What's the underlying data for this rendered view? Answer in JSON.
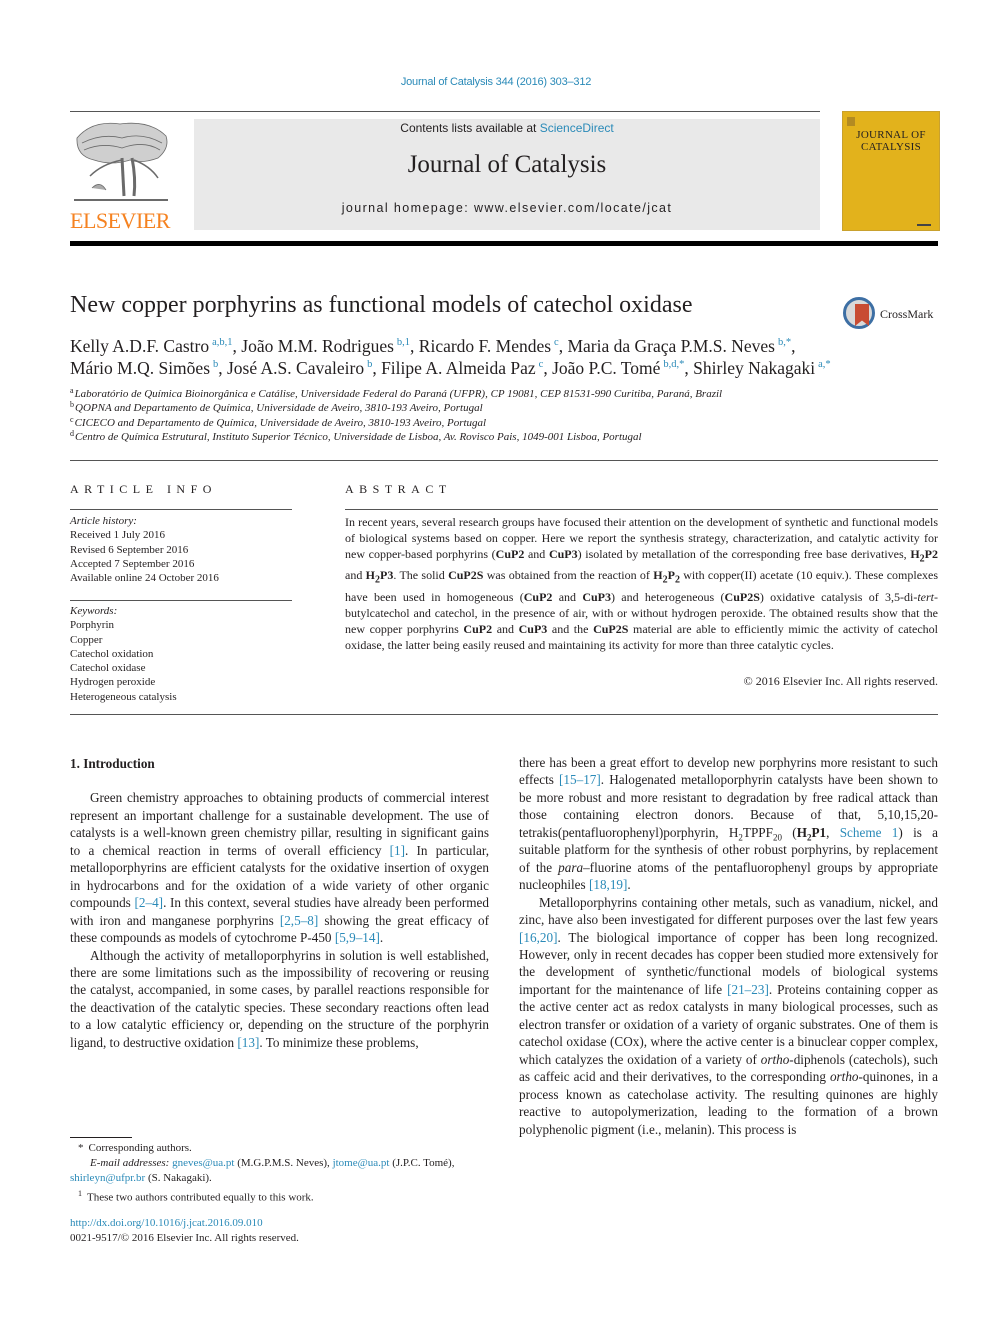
{
  "header": {
    "citation": "Journal of Catalysis 344 (2016) 303–312",
    "contents_prefix": "Contents lists available at ",
    "contents_link": "ScienceDirect",
    "journal_name": "Journal of Catalysis",
    "homepage": "journal homepage: www.elsevier.com/locate/jcat",
    "publisher": "ELSEVIER",
    "cover_title_line1": "JOURNAL OF",
    "cover_title_line2": "CATALYSIS",
    "crossmark_label": "CrossMark"
  },
  "article": {
    "title": "New copper porphyrins as functional models of catechol oxidase",
    "authors": [
      {
        "name": "Kelly A.D.F. Castro",
        "sup": "a,b,1",
        "sep": ", "
      },
      {
        "name": "João M.M. Rodrigues",
        "sup": "b,1",
        "sep": ", "
      },
      {
        "name": "Ricardo F. Mendes",
        "sup": "c",
        "sep": ", "
      },
      {
        "name": "Maria da Graça P.M.S. Neves",
        "sup": "b,*",
        "sep": ","
      },
      {
        "name": "Mário M.Q. Simões",
        "sup": "b",
        "sep": ", "
      },
      {
        "name": "José A.S. Cavaleiro",
        "sup": "b",
        "sep": ", "
      },
      {
        "name": "Filipe A. Almeida Paz",
        "sup": "c",
        "sep": ", "
      },
      {
        "name": "João P.C. Tomé",
        "sup": "b,d,*",
        "sep": ", "
      },
      {
        "name": "Shirley Nakagaki",
        "sup": "a,*",
        "sep": ""
      }
    ],
    "affiliations": [
      {
        "key": "a",
        "text": "Laboratório de Química Bioinorgânica e Catálise, Universidade Federal do Paraná (UFPR), CP 19081, CEP 81531-990 Curitiba, Paraná, Brazil"
      },
      {
        "key": "b",
        "text": "QOPNA and Departamento de Química, Universidade de Aveiro, 3810-193 Aveiro, Portugal"
      },
      {
        "key": "c",
        "text": "CICECO and Departamento de Química, Universidade de Aveiro, 3810-193 Aveiro, Portugal"
      },
      {
        "key": "d",
        "text": "Centro de Química Estrutural, Instituto Superior Técnico, Universidade de Lisboa, Av. Rovisco Pais, 1049-001 Lisboa, Portugal"
      }
    ]
  },
  "article_info": {
    "heading": "ARTICLE INFO",
    "history_label": "Article history:",
    "history": [
      "Received 1 July 2016",
      "Revised 6 September 2016",
      "Accepted 7 September 2016",
      "Available online 24 October 2016"
    ],
    "keywords_label": "Keywords:",
    "keywords": [
      "Porphyrin",
      "Copper",
      "Catechol oxidation",
      "Catechol oxidase",
      "Hydrogen peroxide",
      "Heterogeneous catalysis"
    ]
  },
  "abstract": {
    "heading": "ABSTRACT",
    "segments": [
      {
        "t": "In recent years, several research groups have focused their attention on the development of synthetic and functional models of biological systems based on copper. Here we report the synthesis strategy, characterization, and catalytic activity for new copper-based porphyrins ("
      },
      {
        "t": "CuP2",
        "b": true
      },
      {
        "t": " and "
      },
      {
        "t": "CuP3",
        "b": true
      },
      {
        "t": ") isolated by metallation of the corresponding free base derivatives, "
      },
      {
        "t": "H",
        "b": true
      },
      {
        "t": "2",
        "b": true,
        "sub": true
      },
      {
        "t": "P2",
        "b": true
      },
      {
        "t": " and "
      },
      {
        "t": "H",
        "b": true
      },
      {
        "t": "2",
        "b": true,
        "sub": true
      },
      {
        "t": "P3",
        "b": true
      },
      {
        "t": ". The solid "
      },
      {
        "t": "CuP2S",
        "b": true
      },
      {
        "t": " was obtained from the reaction of "
      },
      {
        "t": "H",
        "b": true
      },
      {
        "t": "2",
        "b": true,
        "sub": true
      },
      {
        "t": "P",
        "b": true
      },
      {
        "t": "2",
        "b": true,
        "sub": true
      },
      {
        "t": " with copper(II) acetate (10 equiv.). These complexes have been used in homogeneous ("
      },
      {
        "t": "CuP2",
        "b": true
      },
      {
        "t": " and "
      },
      {
        "t": "CuP3",
        "b": true
      },
      {
        "t": ") and heterogeneous ("
      },
      {
        "t": "CuP2S",
        "b": true
      },
      {
        "t": ") oxidative catalysis of 3,5-di-"
      },
      {
        "t": "tert",
        "i": true
      },
      {
        "t": "-butylcatechol and catechol, in the presence of air, with or without hydrogen peroxide. The obtained results show that the new copper porphyrins "
      },
      {
        "t": "CuP2",
        "b": true
      },
      {
        "t": " and "
      },
      {
        "t": "CuP3",
        "b": true
      },
      {
        "t": " and the "
      },
      {
        "t": "CuP2S",
        "b": true
      },
      {
        "t": " material are able to efficiently mimic the activity of catechol oxidase, the latter being easily reused and maintaining its activity for more than three catalytic cycles."
      }
    ],
    "copyright": "© 2016 Elsevier Inc. All rights reserved."
  },
  "body": {
    "section_title": "1. Introduction",
    "left_paragraphs": [
      [
        {
          "t": "Green chemistry approaches to obtaining products of commercial interest represent an important challenge for a sustainable development. The use of catalysts is a well-known green chemistry pillar, resulting in significant gains to a chemical reaction in terms of overall efficiency "
        },
        {
          "t": "[1]",
          "link": true
        },
        {
          "t": ". In particular, metalloporphyrins are efficient catalysts for the oxidative insertion of oxygen in hydrocarbons and for the oxidation of a wide variety of other organic compounds "
        },
        {
          "t": "[2–4]",
          "link": true
        },
        {
          "t": ". In this context, several studies have already been performed with iron and manganese porphyrins "
        },
        {
          "t": "[2,5–8]",
          "link": true
        },
        {
          "t": " showing the great efficacy of these compounds as models of cytochrome P-450 "
        },
        {
          "t": "[5,9–14]",
          "link": true
        },
        {
          "t": "."
        }
      ],
      [
        {
          "t": "Although the activity of metalloporphyrins in solution is well established, there are some limitations such as the impossibility of recovering or reusing the catalyst, accompanied, in some cases, by parallel reactions responsible for the deactivation of the catalytic species. These secondary reactions often lead to a low catalytic efficiency or, depending on the structure of the porphyrin ligand, to destructive oxidation "
        },
        {
          "t": "[13]",
          "link": true
        },
        {
          "t": ". To minimize these problems,"
        }
      ]
    ],
    "right_paragraphs": [
      [
        {
          "t": "there has been a great effort to develop new porphyrins more resistant to such effects "
        },
        {
          "t": "[15–17]",
          "link": true
        },
        {
          "t": ". Halogenated metalloporphyrin catalysts have been shown to be more robust and more resistant to degradation by free radical attack than those containing electron donors. Because of that, 5,10,15,20-tetrakis(pentafluorophenyl)porphyrin, H"
        },
        {
          "t": "2",
          "sub": true
        },
        {
          "t": "TPPF"
        },
        {
          "t": "20",
          "sub": true
        },
        {
          "t": " ("
        },
        {
          "t": "H",
          "b": true
        },
        {
          "t": "2",
          "b": true,
          "sub": true
        },
        {
          "t": "P1",
          "b": true
        },
        {
          "t": ", "
        },
        {
          "t": "Scheme 1",
          "link": true
        },
        {
          "t": ") is a suitable platform for the synthesis of other robust porphyrins, by replacement of the "
        },
        {
          "t": "para",
          "i": true
        },
        {
          "t": "–fluorine atoms of the pentafluorophenyl groups by appropriate nucleophiles "
        },
        {
          "t": "[18,19]",
          "link": true
        },
        {
          "t": "."
        }
      ],
      [
        {
          "t": "Metalloporphyrins containing other metals, such as vanadium, nickel, and zinc, have also been investigated for different purposes over the last few years "
        },
        {
          "t": "[16,20]",
          "link": true
        },
        {
          "t": ". The biological importance of copper has been long recognized. However, only in recent decades has copper been studied more extensively for the development of synthetic/functional models of biological systems important for the maintenance of life "
        },
        {
          "t": "[21–23]",
          "link": true
        },
        {
          "t": ". Proteins containing copper as the active center act as redox catalysts in many biological processes, such as electron transfer or oxidation of a variety of organic substrates. One of them is catechol oxidase (COx), where the active center is a binuclear copper complex, which catalyzes the oxidation of a variety of "
        },
        {
          "t": "ortho",
          "i": true
        },
        {
          "t": "-diphenols (catechols), such as caffeic acid and their derivatives, to the corresponding "
        },
        {
          "t": "ortho",
          "i": true
        },
        {
          "t": "-quinones, in a process known as catecholase activity. The resulting quinones are highly reactive to autopolymerization, leading to the formation of a brown polyphenolic pigment (i.e., melanin). This process is"
        }
      ]
    ]
  },
  "footnotes": {
    "corresponding_mark": "*",
    "corresponding": "Corresponding authors.",
    "email_label": "E-mail addresses:",
    "emails": [
      {
        "email": "gneves@ua.pt",
        "name": " (M.G.P.M.S. Neves), "
      },
      {
        "email": "jtome@ua.pt",
        "name": " (J.P.C. Tomé), "
      },
      {
        "email": "shirleyn@ufpr.br",
        "name": " (S. Nakagaki)."
      }
    ],
    "equal_mark": "1",
    "equal": "These two authors contributed equally to this work.",
    "doi": "http://dx.doi.org/10.1016/j.jcat.2016.09.010",
    "issn": "0021-9517/© 2016 Elsevier Inc. All rights reserved."
  },
  "colors": {
    "link": "#2a8ab8",
    "elsevier_orange": "#f58220",
    "cover_yellow": "#e2b21c",
    "masthead_gray": "#e9e9e9"
  }
}
